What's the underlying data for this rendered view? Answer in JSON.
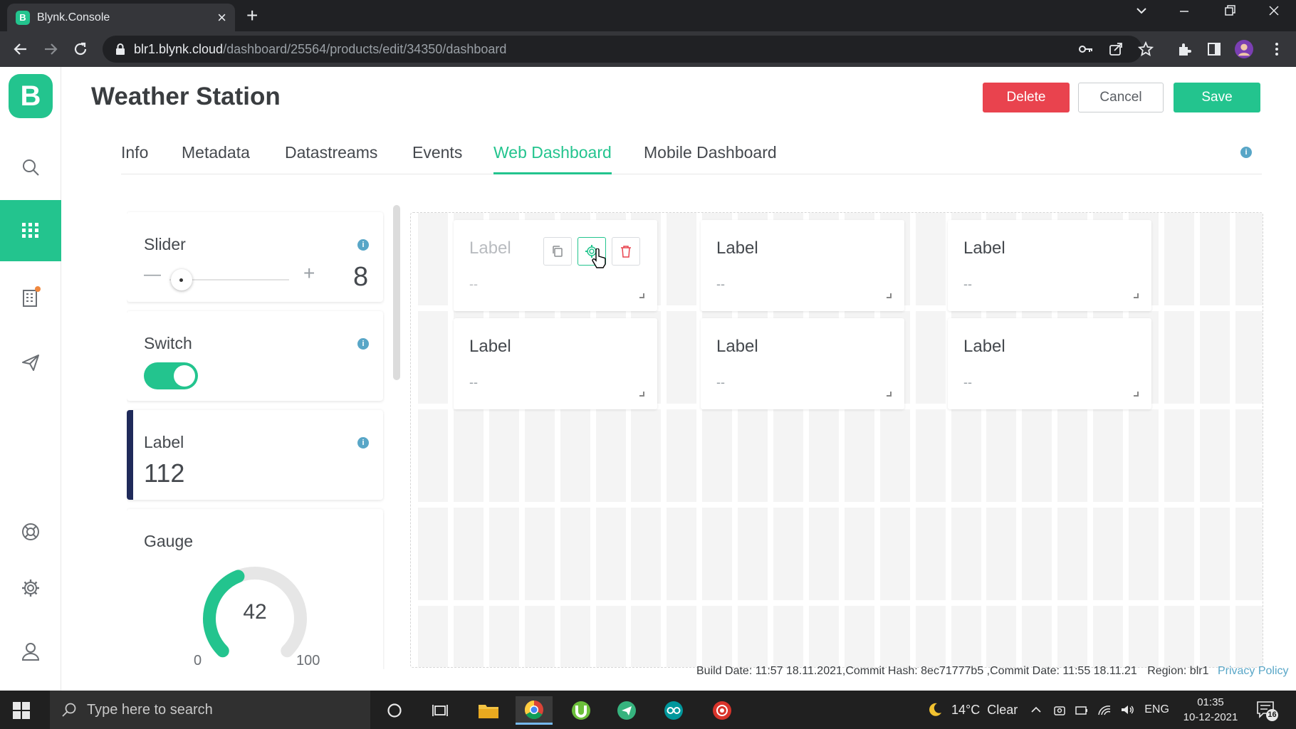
{
  "browser": {
    "tab_title": "Blynk.Console",
    "favicon_letter": "B",
    "url_host": "blr1.blynk.cloud",
    "url_path": "/dashboard/25564/products/edit/34350/dashboard"
  },
  "app": {
    "logo_letter": "B",
    "title": "Weather Station",
    "buttons": {
      "delete": "Delete",
      "cancel": "Cancel",
      "save": "Save"
    },
    "tabs": [
      "Info",
      "Metadata",
      "Datastreams",
      "Events",
      "Web Dashboard",
      "Mobile Dashboard"
    ],
    "active_tab": "Web Dashboard",
    "info_glyph": "i"
  },
  "palette": {
    "slider": {
      "title": "Slider",
      "value": "8",
      "minus": "—",
      "plus": "+",
      "position": 0.1
    },
    "switch": {
      "title": "Switch",
      "state": true
    },
    "label": {
      "title": "Label",
      "value": "112"
    },
    "gauge": {
      "title": "Gauge",
      "value": "42",
      "min": "0",
      "max": "100",
      "fill": 0.42
    }
  },
  "canvas": {
    "cards": [
      {
        "title": "Label",
        "value": "--"
      },
      {
        "title": "Label",
        "value": "--"
      },
      {
        "title": "Label",
        "value": "--"
      },
      {
        "title": "Label",
        "value": "--"
      },
      {
        "title": "Label",
        "value": "--"
      },
      {
        "title": "Label",
        "value": "--"
      }
    ]
  },
  "footer": {
    "build": "Build Date: 11:57 18.11.2021,Commit Hash: 8ec71777b5 ,Commit Date: 11:55 18.11.21",
    "region": "Region: blr1",
    "privacy": "Privacy Policy"
  },
  "taskbar": {
    "search_placeholder": "Type here to search",
    "weather": "14°C  Clear",
    "lang": "ENG",
    "time": "01:35",
    "date": "10-12-2021",
    "notifications": "16"
  },
  "colors": {
    "accent": "#23c48e",
    "danger": "#e9434e",
    "info": "#58a6c7",
    "label_bar": "#1f2a5a"
  }
}
